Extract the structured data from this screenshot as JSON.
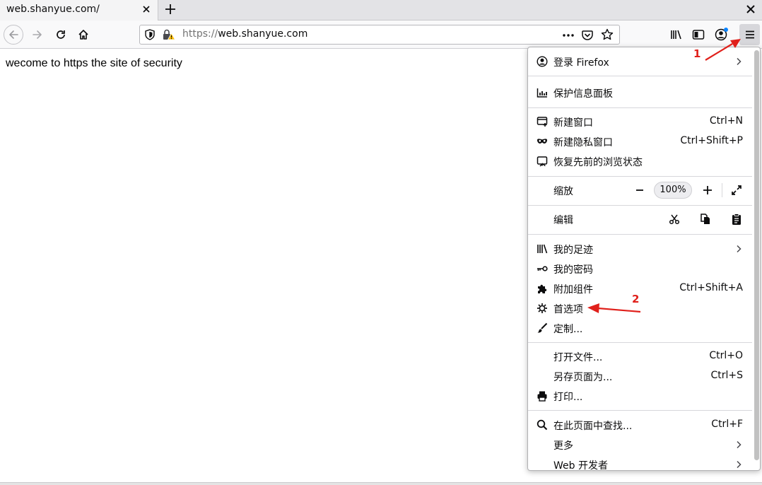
{
  "tab": {
    "title": "web.shanyue.com/"
  },
  "urlbar": {
    "prefix": "https://",
    "host": "web.shanyue.com"
  },
  "page": {
    "text": "wecome to https the site of security"
  },
  "menu": {
    "sign_in": {
      "label": "登录 Firefox"
    },
    "protections": {
      "label": "保护信息面板"
    },
    "new_window": {
      "label": "新建窗口",
      "shortcut": "Ctrl+N"
    },
    "new_private": {
      "label": "新建隐私窗口",
      "shortcut": "Ctrl+Shift+P"
    },
    "restore_session": {
      "label": "恢复先前的浏览状态"
    },
    "zoom": {
      "label": "缩放",
      "value": "100%"
    },
    "edit": {
      "label": "编辑"
    },
    "library": {
      "label": "我的足迹"
    },
    "logins": {
      "label": "我的密码"
    },
    "addons": {
      "label": "附加组件",
      "shortcut": "Ctrl+Shift+A"
    },
    "preferences": {
      "label": "首选项"
    },
    "customize": {
      "label": "定制..."
    },
    "open_file": {
      "label": "打开文件...",
      "shortcut": "Ctrl+O"
    },
    "save_page": {
      "label": "另存页面为...",
      "shortcut": "Ctrl+S"
    },
    "print": {
      "label": "打印..."
    },
    "find": {
      "label": "在此页面中查找...",
      "shortcut": "Ctrl+F"
    },
    "more": {
      "label": "更多"
    },
    "web_developer": {
      "label": "Web 开发者"
    }
  },
  "annotations": {
    "step1": "1",
    "step2": "2",
    "color": "#e0201b"
  },
  "colors": {
    "accent": "#0a84ff",
    "toolbar": "#f9f9fa",
    "tabstrip": "#e3e3e6"
  },
  "icons": [
    "back-arrow-icon",
    "forward-arrow-icon",
    "reload-icon",
    "home-icon",
    "shield-icon",
    "insecure-lock-icon",
    "more-dots-icon",
    "pocket-icon",
    "star-icon",
    "library-icon",
    "sidebar-icon",
    "account-icon",
    "hamburger-menu-icon"
  ]
}
